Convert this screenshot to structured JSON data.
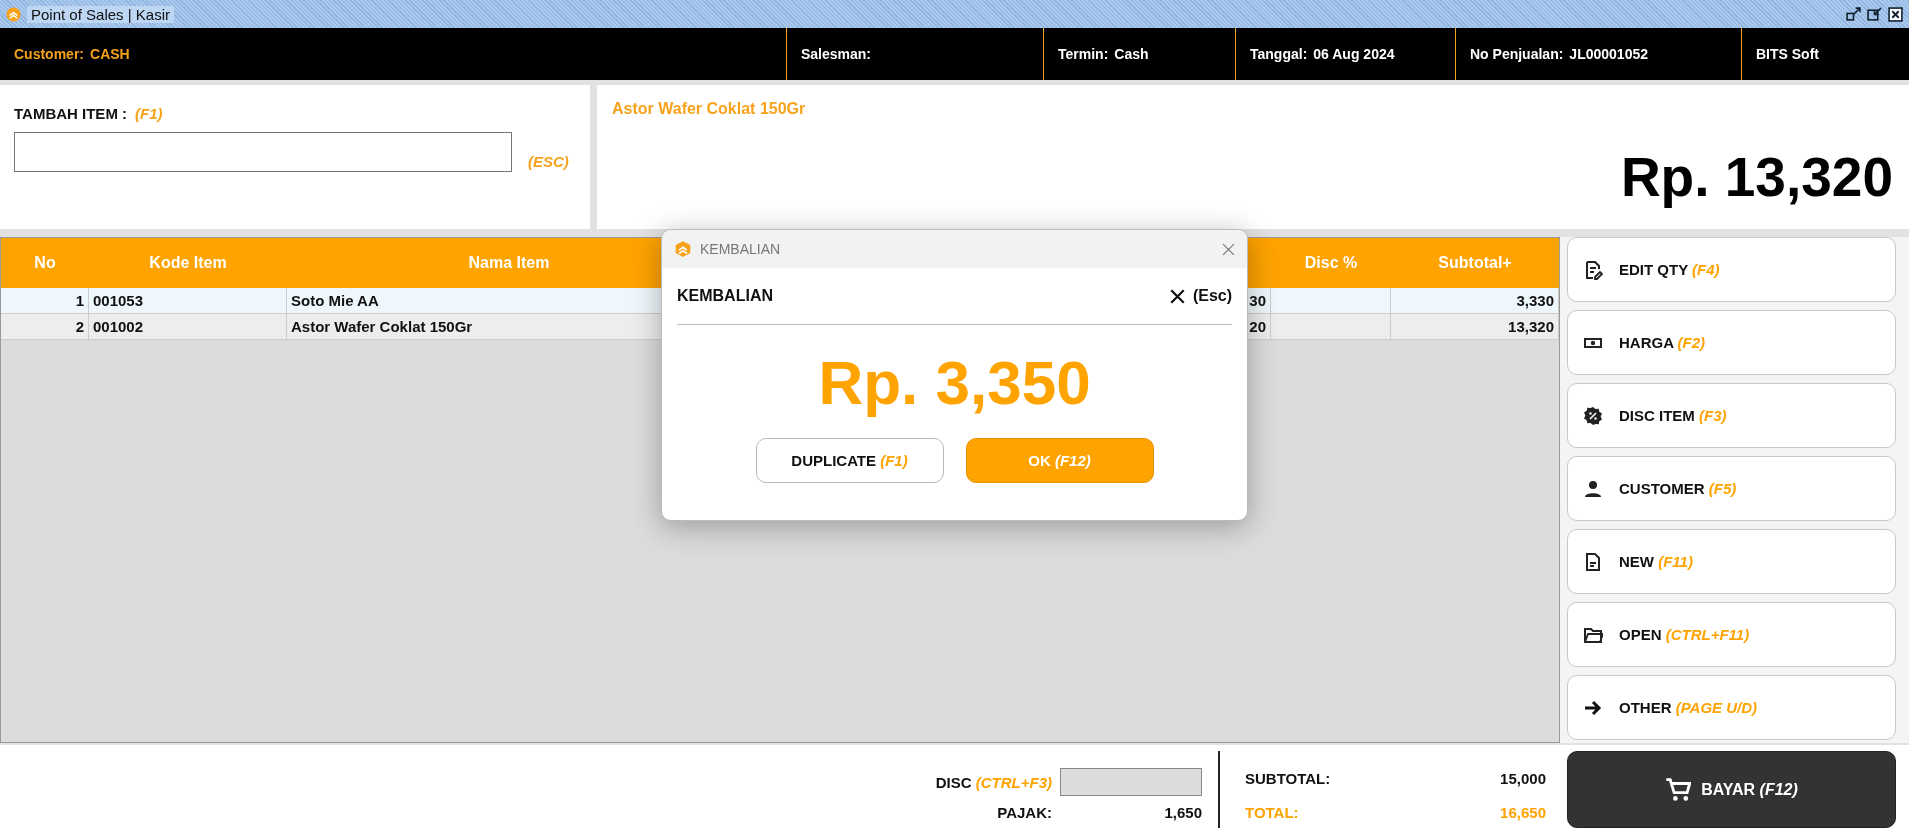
{
  "window": {
    "title": "Point of Sales | Kasir"
  },
  "header": {
    "fields": [
      {
        "label": "Customer:",
        "value": "CASH",
        "highlight": true
      },
      {
        "label": "Salesman:",
        "highlight": false
      },
      {
        "label": "Termin:",
        "value": "Cash",
        "highlight": false
      },
      {
        "label": "Tanggal:",
        "value": "06 Aug 2024",
        "highlight": false
      },
      {
        "label": "No Penjualan:",
        "value": "JL00001052",
        "highlight": false
      }
    ],
    "brand": "BITS Soft"
  },
  "add_item": {
    "label": "TAMBAH ITEM :",
    "shortcut": "(F1)",
    "esc_hint": "(ESC)"
  },
  "product_display": {
    "name": "Astor Wafer Coklat 150Gr",
    "price": "Rp. 13,320"
  },
  "table": {
    "columns": {
      "no": "No",
      "kode": "Kode Item",
      "nama": "Nama Item",
      "disc": "Disc %",
      "subtotal": "Subtotal+"
    },
    "rows": [
      {
        "no": "1",
        "kode": "001053",
        "nama": "Soto Mie AA",
        "column_4": "30",
        "subtotal": "3,330",
        "selected": true
      },
      {
        "no": "2",
        "kode": "001002",
        "nama": "Astor Wafer Coklat 150Gr",
        "column_4": "20",
        "subtotal": "13,320",
        "selected": false
      }
    ]
  },
  "dialog": {
    "title": "KEMBALIAN",
    "heading": "KEMBALIAN",
    "close_hint": "(Esc)",
    "amount": "Rp. 3,350",
    "buttons": [
      {
        "label": "DUPLICATE",
        "shortcut": "(F1)",
        "kind": "secondary"
      },
      {
        "label": "OK",
        "shortcut": "(F12)",
        "kind": "primary"
      }
    ]
  },
  "actions": [
    {
      "label": "EDIT QTY",
      "shortcut": "(F4)",
      "kind": "edit"
    },
    {
      "label": "HARGA",
      "shortcut": "(F2)",
      "kind": "money"
    },
    {
      "label": "DISC ITEM",
      "shortcut": "(F3)",
      "kind": "discount"
    },
    {
      "label": "CUSTOMER",
      "shortcut": "(F5)",
      "kind": "person"
    },
    {
      "label": "NEW",
      "shortcut": "(F11)",
      "kind": "document"
    },
    {
      "label": "OPEN",
      "shortcut": "(CTRL+F11)",
      "kind": "folder"
    },
    {
      "label": "OTHER",
      "shortcut": "(PAGE U/D)",
      "kind": "arrow"
    }
  ],
  "totals": {
    "disc_label": "DISC",
    "disc_shortcut": "(CTRL+F3)",
    "pajak_label": "PAJAK:",
    "pajak": "1,650",
    "subtotal_label": "SUBTOTAL:",
    "subtotal": "15,000",
    "total_label": "TOTAL:",
    "total": "16,650"
  },
  "pay_button": {
    "label": "BAYAR",
    "shortcut": "(F12)"
  }
}
